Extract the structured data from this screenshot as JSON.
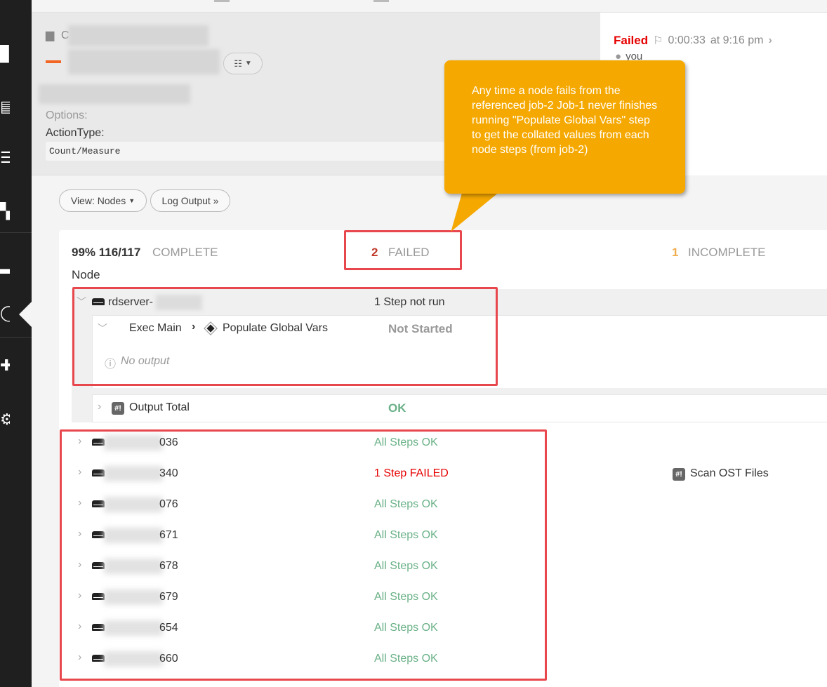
{
  "job": {
    "group_partial": "C",
    "options_label": "Options:",
    "action_type_label": "ActionType:",
    "action_type_value": "Count/Measure"
  },
  "execution": {
    "status": "Failed",
    "duration": "0:00:33",
    "time": "at 9:16 pm",
    "user": "you"
  },
  "toolbar": {
    "view_label": "View: Nodes",
    "log_label": "Log Output »"
  },
  "summary": {
    "percent": "99% 116/117",
    "complete_label": "COMPLETE",
    "failed_count": "2",
    "failed_label": "FAILED",
    "incomplete_count": "1",
    "incomplete_label": "INCOMPLETE",
    "node_header": "Node"
  },
  "expanded_node": {
    "name": "rdserver-",
    "status": "1 Step not run",
    "step_parent": "Exec Main",
    "step_name": "Populate Global Vars",
    "step_status": "Not Started",
    "no_output": "No output",
    "output_step": "Output Total",
    "output_status": "OK"
  },
  "hosts": [
    {
      "suffix": "036",
      "status": "All Steps OK",
      "failed": false
    },
    {
      "suffix": "340",
      "status": "1 Step FAILED",
      "failed": true,
      "failed_step": "Scan OST Files"
    },
    {
      "suffix": "076",
      "status": "All Steps OK",
      "failed": false
    },
    {
      "suffix": "671",
      "status": "All Steps OK",
      "failed": false
    },
    {
      "suffix": "678",
      "status": "All Steps OK",
      "failed": false
    },
    {
      "suffix": "679",
      "status": "All Steps OK",
      "failed": false
    },
    {
      "suffix": "654",
      "status": "All Steps OK",
      "failed": false
    },
    {
      "suffix": "660",
      "status": "All Steps OK",
      "failed": false
    }
  ],
  "callout": {
    "text": "Any time a node fails from the referenced job-2 Job-1 never finishes running \"Populate Global Vars\" step to get the collated values from each node steps (from job-2)"
  },
  "colors": {
    "failed": "#e60000",
    "ok": "#6ab187",
    "incomplete": "#f0ad4e",
    "callout": "#f5a800",
    "annotation": "#e9474e"
  }
}
